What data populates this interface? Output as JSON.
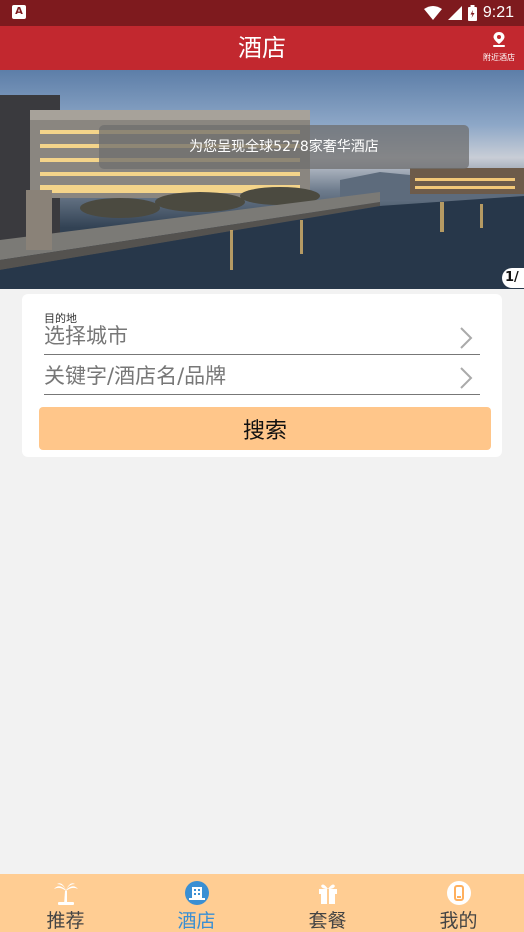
{
  "status_bar": {
    "time": "9:21",
    "left_badge": "A"
  },
  "header": {
    "title": "酒店",
    "nearby_label": "附近酒店"
  },
  "banner": {
    "caption": "为您呈现全球5278家奢华酒店",
    "pager": "1/"
  },
  "search": {
    "destination_label": "目的地",
    "city_placeholder": "选择城市",
    "keyword_placeholder": "关键字/酒店名/品牌",
    "button_label": "搜索"
  },
  "colors": {
    "status_bar": "#7e1a1e",
    "header": "#c2282f",
    "search_button": "#ffc68a",
    "bottom_nav": "#ffcd93",
    "active_tab": "#3a8fd3"
  },
  "bottom_nav": {
    "tabs": [
      {
        "label": "推荐",
        "icon": "palm-tree-icon"
      },
      {
        "label": "酒店",
        "icon": "hotel-icon",
        "active": true
      },
      {
        "label": "套餐",
        "icon": "gift-icon"
      },
      {
        "label": "我的",
        "icon": "profile-icon"
      }
    ]
  }
}
